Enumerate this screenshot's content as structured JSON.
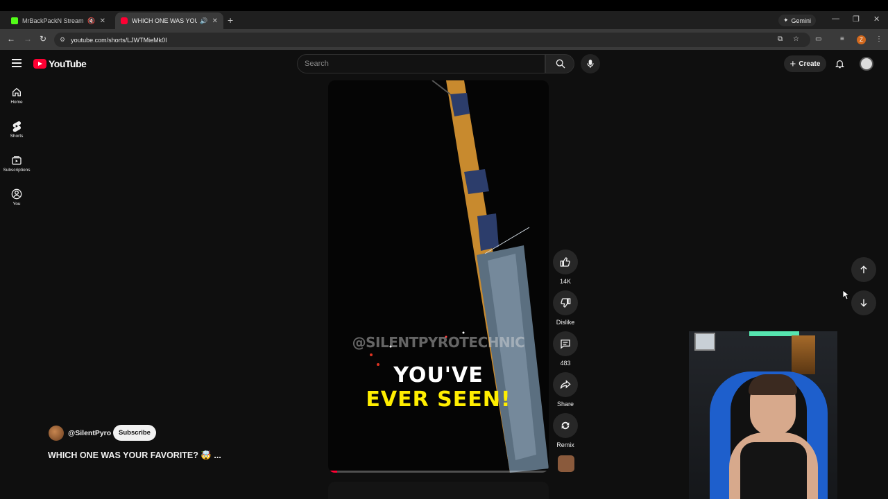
{
  "browser": {
    "tabs": [
      {
        "title": "MrBackPackN Stream - Watch",
        "active": false
      },
      {
        "title": "WHICH ONE WAS YOUR FAVORITE",
        "active": true
      }
    ],
    "gemini_label": "Gemini",
    "url": "youtube.com/shorts/LJWTMieMk0I",
    "profile_initial": "Z"
  },
  "header": {
    "logo_text": "YouTube",
    "search_placeholder": "Search",
    "create_label": "Create"
  },
  "sidebar": {
    "items": [
      {
        "label": "Home",
        "icon": "home-icon"
      },
      {
        "label": "Shorts",
        "icon": "shorts-icon"
      },
      {
        "label": "Subscriptions",
        "icon": "subscriptions-icon"
      },
      {
        "label": "You",
        "icon": "you-icon"
      }
    ]
  },
  "video": {
    "overlay_handle": "@SILENTPYROTECHNIC",
    "overlay_line1": "YOU'VE",
    "overlay_line2": "EVER SEEN!",
    "progress": 0.04
  },
  "actions": {
    "likes": "14K",
    "dislike_label": "Dislike",
    "comments": "483",
    "share_label": "Share",
    "remix_label": "Remix"
  },
  "channel": {
    "handle": "@SilentPyro",
    "subscribe_label": "Subscribe"
  },
  "title": "WHICH ONE WAS YOUR FAVORITE? 🤯 ...",
  "colors": {
    "brand_red": "#ff0033",
    "overlay_yellow": "#ffee00",
    "background": "#0f0f0f"
  }
}
